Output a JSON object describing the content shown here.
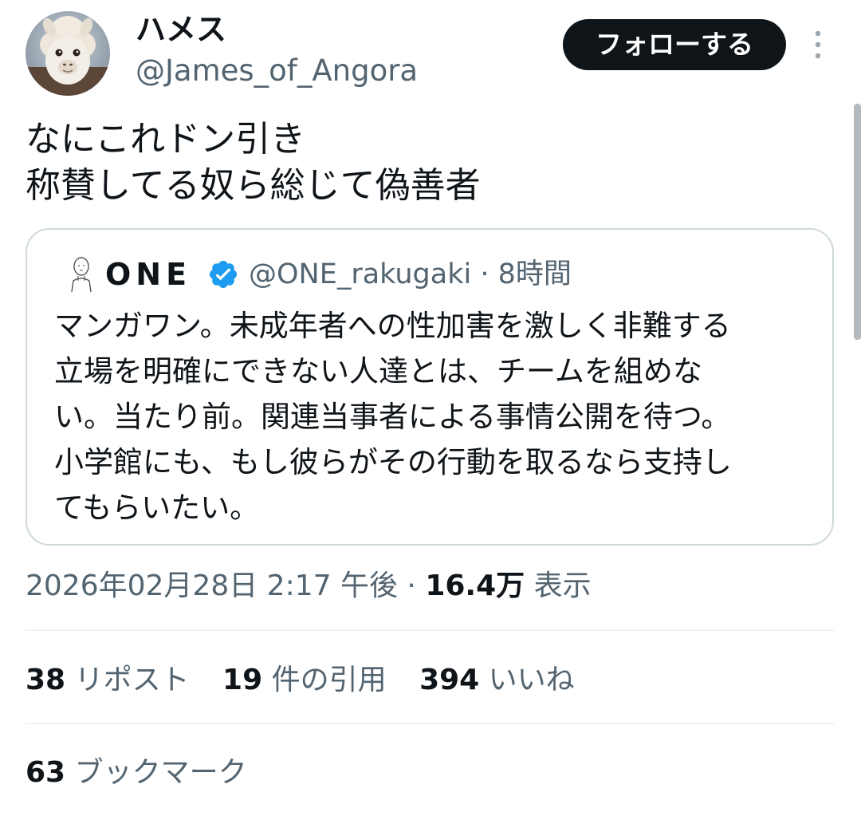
{
  "header": {
    "avatar_icon": "alpaca-avatar",
    "display_name": "ハメス",
    "handle": "@James_of_Angora",
    "follow_label": "フォローする",
    "more_icon": "more-vertical-icon"
  },
  "tweet": {
    "lines": [
      "なにこれドン引き",
      "称賛してる奴ら総じて偽善者"
    ]
  },
  "quote": {
    "avatar_icon": "sketch-person-avatar",
    "name": "ONE",
    "verified_icon": "verified-badge-icon",
    "handle": "@ONE_rakugaki",
    "separator": "·",
    "time": "8時間",
    "body_lines": [
      "マンガワン。未成年者への性加害を激しく非難する",
      "立場を明確にできない人達とは、チームを組めな",
      "い。当たり前。関連当事者による事情公開を待つ。",
      "小学館にも、もし彼らがその行動を取るなら支持し",
      "てもらいたい。"
    ]
  },
  "meta": {
    "timestamp": "2026年02月28日 2:17 午後",
    "separator": "·",
    "views_count": "16.4万",
    "views_label": "表示"
  },
  "stats": {
    "reposts": {
      "count": "38",
      "label": "リポスト"
    },
    "quotes": {
      "count": "19",
      "label": "件の引用"
    },
    "likes": {
      "count": "394",
      "label": "いいね"
    },
    "bookmarks": {
      "count": "63",
      "label": "ブックマーク"
    }
  },
  "colors": {
    "primary_text": "#0f1419",
    "secondary_text": "#536471",
    "border": "#cfd9de",
    "divider": "#eff3f4",
    "verified_blue": "#1d9bf0",
    "button_bg": "#0f1419"
  }
}
